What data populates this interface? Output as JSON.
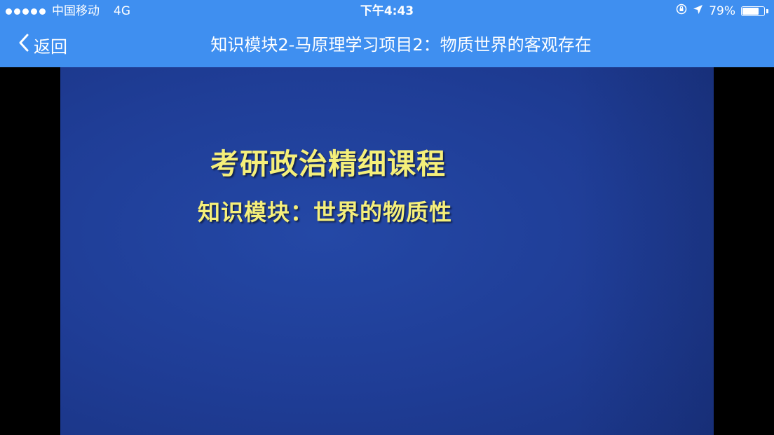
{
  "status_bar": {
    "carrier": "中国移动",
    "network": "4G",
    "time": "下午4:43",
    "battery_text": "79%",
    "battery_level": 0.79,
    "icons": [
      "signal-dots-icon",
      "orientation-lock-icon",
      "location-arrow-icon",
      "battery-icon"
    ]
  },
  "nav": {
    "back_label": "返回",
    "title": "知识模块2-马原理学习项目2：物质世界的客观存在"
  },
  "video": {
    "title": "考研政治精细课程",
    "subtitle": "知识模块：世界的物质性"
  },
  "colors": {
    "header": "#3f8ff0",
    "video_bg": "#2448a6",
    "video_text": "#f5ef7a"
  }
}
